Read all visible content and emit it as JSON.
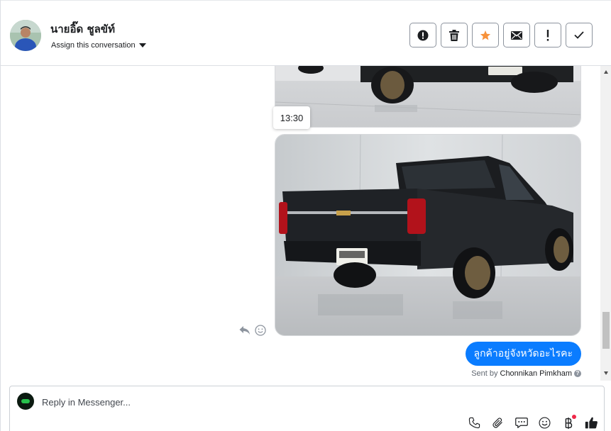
{
  "header": {
    "contact_name": "นายอิ๊ด ชูลขัท์",
    "assign_label": "Assign this conversation",
    "actions": [
      {
        "name": "spam-button",
        "icon": "alert-circle-icon"
      },
      {
        "name": "delete-button",
        "icon": "trash-icon"
      },
      {
        "name": "star-button",
        "icon": "star-icon",
        "color": "#f7923b"
      },
      {
        "name": "mark-unread-button",
        "icon": "envelope-icon"
      },
      {
        "name": "follow-up-button",
        "icon": "exclamation-icon"
      },
      {
        "name": "done-button",
        "icon": "checkmark-icon"
      }
    ]
  },
  "conversation": {
    "timestamp": "13:30",
    "outgoing_message": "ลูกค้าอยู่จังหวัดอะไรคะ",
    "sent_by_prefix": "Sent by",
    "sent_by_name": "Chonnikan Pimkham",
    "accent_color": "#0a7cff"
  },
  "composer": {
    "placeholder": "Reply in Messenger...",
    "tools": [
      "phone-icon",
      "paperclip-icon",
      "saved-reply-icon",
      "emoji-icon",
      "baht-payment-icon",
      "thumbs-up-icon"
    ]
  }
}
